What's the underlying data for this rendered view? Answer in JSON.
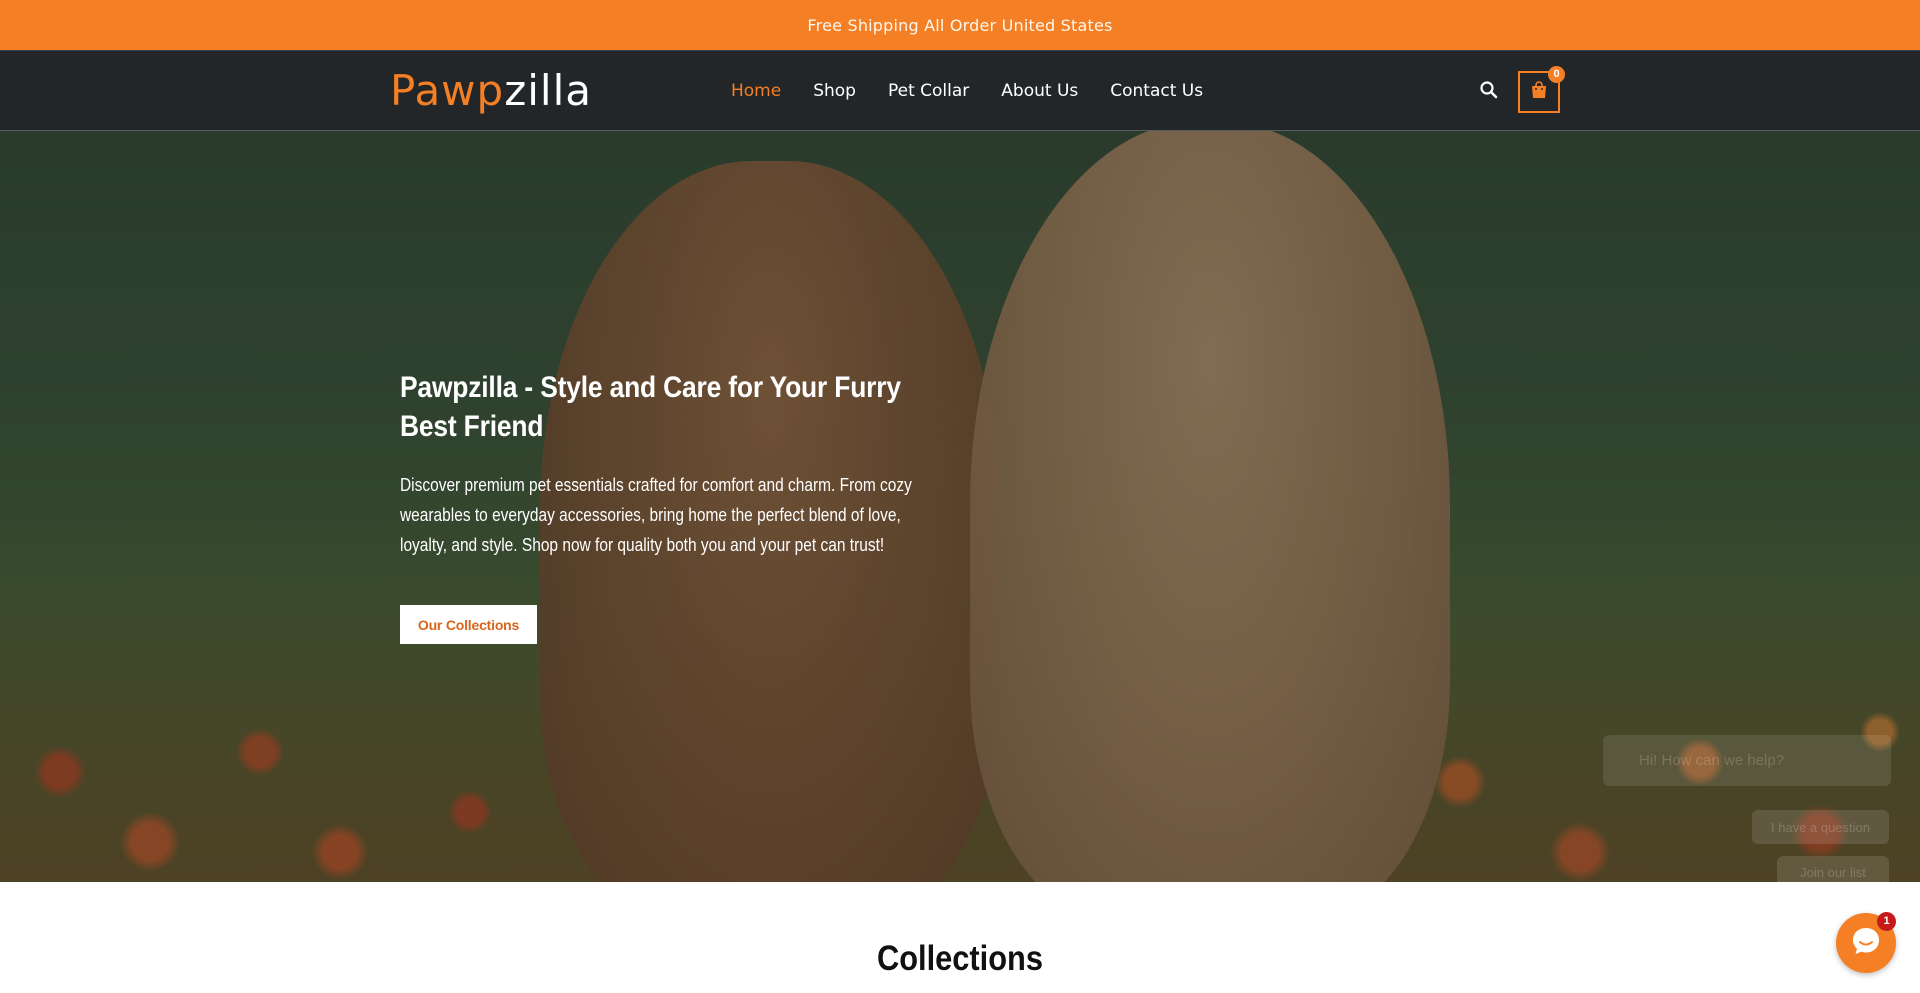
{
  "announcement": {
    "text": "Free Shipping All Order United States"
  },
  "header": {
    "logo_part1": "Pawp",
    "logo_part2": "zilla",
    "nav": [
      {
        "label": "Home",
        "active": true
      },
      {
        "label": "Shop",
        "active": false
      },
      {
        "label": "Pet Collar",
        "active": false
      },
      {
        "label": "About Us",
        "active": false
      },
      {
        "label": "Contact Us",
        "active": false
      }
    ],
    "search_icon": "search-icon",
    "cart_icon": "shopping-bag-icon",
    "cart_count": "0"
  },
  "hero": {
    "title": "Pawpzilla - Style and Care for Your Furry Best Friend",
    "description": "Discover premium pet essentials crafted for comfort and charm. From cozy wearables to everyday accessories, bring home the perfect blend of love, loyalty, and style. Shop now for quality both you and your pet can trust!",
    "cta_label": "Our Collections"
  },
  "chat": {
    "greeting": "Hi! How can we help?",
    "option_question": "I have a question",
    "option_join": "Join our list",
    "launcher_icon": "chat-icon",
    "badge_count": "1"
  },
  "sections": {
    "collections_title": "Collections"
  },
  "colors": {
    "accent": "#f47f24",
    "header_bg": "#232629",
    "badge": "#c81a1a"
  }
}
